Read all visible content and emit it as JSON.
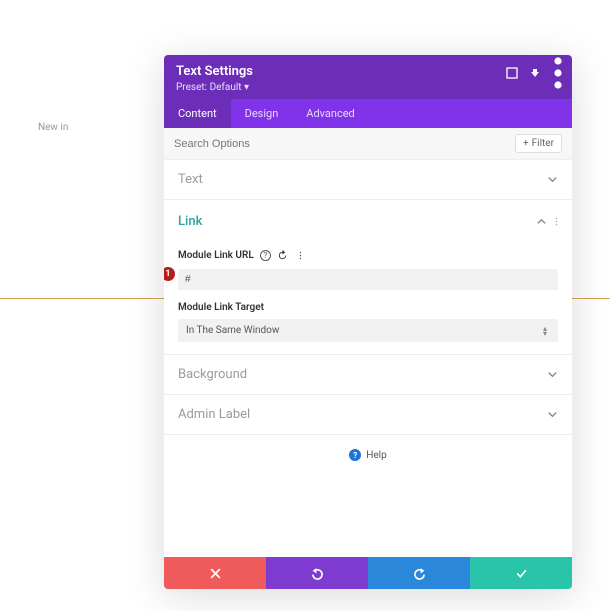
{
  "page": {
    "background_text": "New in"
  },
  "header": {
    "title": "Text Settings",
    "preset_label": "Preset:",
    "preset_value": "Default"
  },
  "tabs": [
    "Content",
    "Design",
    "Advanced"
  ],
  "search": {
    "placeholder": "Search Options",
    "filter": "Filter"
  },
  "sections": {
    "text": {
      "title": "Text"
    },
    "link": {
      "title": "Link",
      "url_label": "Module Link URL",
      "url_value": "#",
      "badge_num": "1",
      "target_label": "Module Link Target",
      "target_value": "In The Same Window"
    },
    "background": {
      "title": "Background"
    },
    "admin": {
      "title": "Admin Label"
    }
  },
  "help": {
    "text": "Help"
  }
}
